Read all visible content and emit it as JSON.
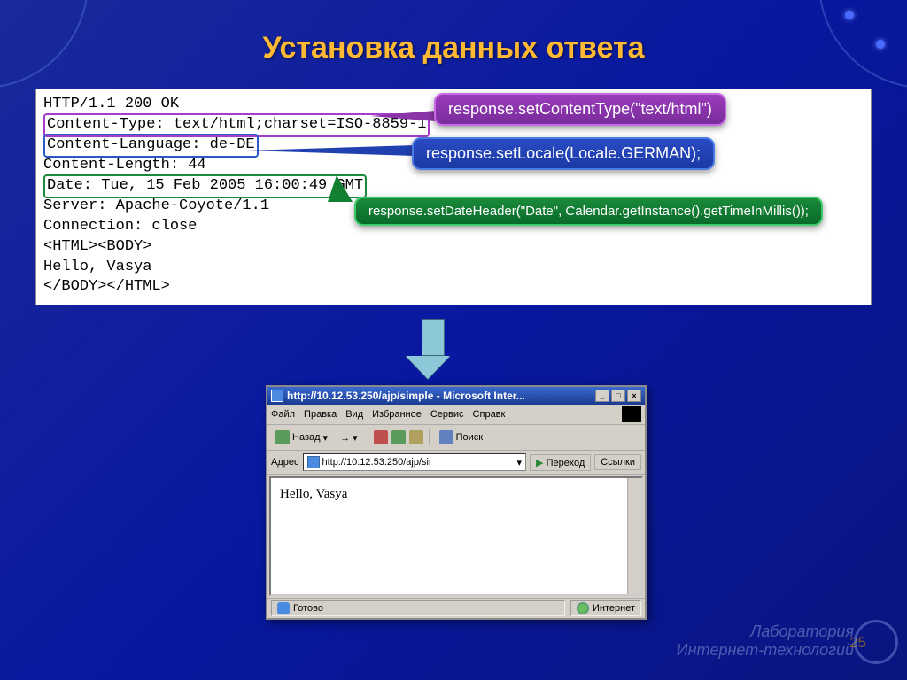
{
  "title": "Установка данных ответа",
  "code": {
    "line1": "HTTP/1.1 200 OK",
    "line2": "Content-Type: text/html;charset=ISO-8859-1",
    "line3": "Content-Language: de-DE",
    "line4": "Content-Length: 44",
    "line5": "Date: Tue, 15 Feb 2005 16:00:49 GMT",
    "line6": "Server: Apache-Coyote/1.1",
    "line7": "Connection: close",
    "line8": "",
    "line9": "<HTML><BODY>",
    "line10": "Hello, Vasya",
    "line11": "</BODY></HTML>"
  },
  "callouts": {
    "purple": "response.setContentType(\"text/html\")",
    "blue": "response.setLocale(Locale.GERMAN);",
    "green": "response.setDateHeader(\"Date\",  Calendar.getInstance().getTimeInMillis());"
  },
  "browser": {
    "title": "http://10.12.53.250/ajp/simple - Microsoft Inter...",
    "menu": {
      "file": "Файл",
      "edit": "Правка",
      "view": "Вид",
      "fav": "Избранное",
      "tools": "Сервис",
      "help": "Справк"
    },
    "toolbar": {
      "back": "Назад",
      "search": "Поиск"
    },
    "addr_label": "Адрес",
    "url": "http://10.12.53.250/ajp/sir",
    "go": "Переход",
    "links": "Ссылки",
    "page_text": "Hello, Vasya",
    "status_done": "Готово",
    "status_zone": "Интернет"
  },
  "slide_number": "25",
  "footer": {
    "line1": "Лаборатория",
    "line2": "Интернет-технологий"
  }
}
